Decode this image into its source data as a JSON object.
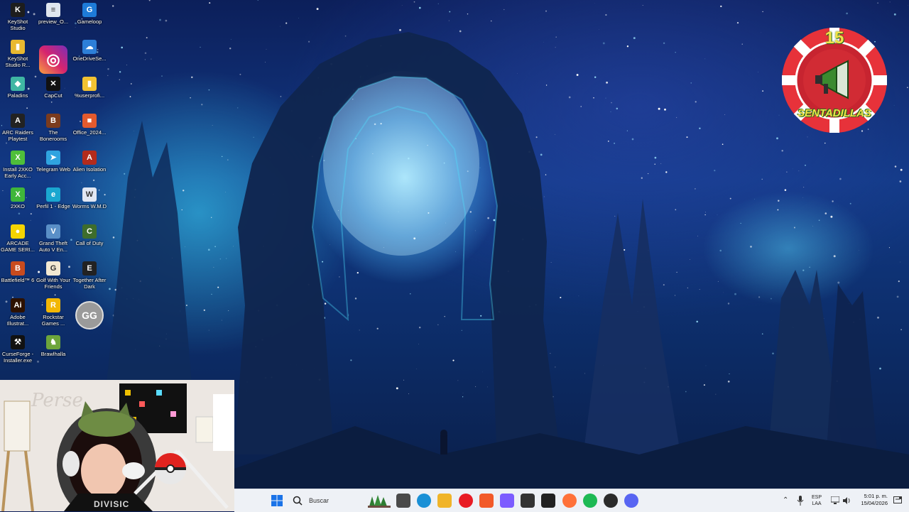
{
  "desktop": {
    "icons": [
      {
        "label": "KeyShot Studio",
        "glyph": "K",
        "color": "#1d1d1d",
        "icon": "keyshot-icon"
      },
      {
        "label": "preview_O...",
        "glyph": "≡",
        "color": "#dfe6ef",
        "icon": "document-icon"
      },
      {
        "label": "Gameloop",
        "glyph": "G",
        "color": "#1e7bd8",
        "icon": "gameloop-icon"
      },
      {
        "label": "KeyShot Studio R...",
        "glyph": "▮",
        "color": "#e9b930",
        "icon": "folder-icon"
      },
      {
        "label": "",
        "glyph": "◎",
        "color": "#c1355b",
        "icon": "instagram-icon"
      },
      {
        "label": "OneDriveSe...",
        "glyph": "☁",
        "color": "#2d7fd8",
        "icon": "onedrive-icon"
      },
      {
        "label": "Paladins",
        "glyph": "◆",
        "color": "#3fb6a3",
        "icon": "paladins-icon"
      },
      {
        "label": "CapCut",
        "glyph": "✕",
        "color": "#111111",
        "icon": "capcut-icon"
      },
      {
        "label": "%userprofi...",
        "glyph": "▮",
        "color": "#f1c232",
        "icon": "folder-icon"
      },
      {
        "label": "ARC Raiders Playtest",
        "glyph": "A",
        "color": "#222222",
        "icon": "arc-raiders-icon"
      },
      {
        "label": "The Bonerooms",
        "glyph": "B",
        "color": "#7b3b1e",
        "icon": "bonerooms-icon"
      },
      {
        "label": "Office_2024...",
        "glyph": "■",
        "color": "#e35a2e",
        "icon": "office-icon"
      },
      {
        "label": "Install 2XKO Early Acc...",
        "glyph": "X",
        "color": "#4fbf3a",
        "icon": "2xko-installer-icon"
      },
      {
        "label": "Telegram Web",
        "glyph": "➤",
        "color": "#2fa3e0",
        "icon": "telegram-icon"
      },
      {
        "label": "Alien Isolation",
        "glyph": "A",
        "color": "#b32b1c",
        "icon": "alien-isolation-icon"
      },
      {
        "label": "2XKO",
        "glyph": "X",
        "color": "#3fb63a",
        "icon": "2xko-icon"
      },
      {
        "label": "Perfil 1 - Edge",
        "glyph": "e",
        "color": "#1aa7d0",
        "icon": "edge-icon"
      },
      {
        "label": "Worms W.M.D",
        "glyph": "W",
        "color": "#e1e7f3",
        "icon": "worms-icon"
      },
      {
        "label": "ARCADE GAME SERI...",
        "glyph": "●",
        "color": "#f5d400",
        "icon": "pacman-icon"
      },
      {
        "label": "Grand Theft Auto V En...",
        "glyph": "V",
        "color": "#5a8fc7",
        "icon": "gta-icon"
      },
      {
        "label": "Call of Duty",
        "glyph": "C",
        "color": "#3e6d2c",
        "icon": "call-of-duty-icon"
      },
      {
        "label": "Battlefield™ 6",
        "glyph": "B",
        "color": "#c84b1e",
        "icon": "battlefield-icon"
      },
      {
        "label": "Golf With Your Friends",
        "glyph": "G",
        "color": "#f2e8d2",
        "icon": "golf-icon"
      },
      {
        "label": "Together After Dark",
        "glyph": "E",
        "color": "#222222",
        "icon": "epic-games-icon"
      },
      {
        "label": "Adobe Illustrat...",
        "glyph": "Ai",
        "color": "#2d1100",
        "icon": "illustrator-icon"
      },
      {
        "label": "Rockstar Games ...",
        "glyph": "R",
        "color": "#f2b705",
        "icon": "rockstar-icon"
      },
      {
        "label": "",
        "glyph": "GG",
        "color": "#9a9a9a",
        "icon": "gg-icon"
      },
      {
        "label": "CurseForge - Installer.exe",
        "glyph": "⚒",
        "color": "#111111",
        "icon": "curseforge-icon"
      },
      {
        "label": "Brawlhalla",
        "glyph": "♞",
        "color": "#6da53b",
        "icon": "brawlhalla-icon"
      }
    ]
  },
  "badge": {
    "number": "15",
    "text": "SENTADILLAS"
  },
  "webcam": {
    "wall_text": "Perse",
    "shirt_text": "DIVISIC"
  },
  "taskbar": {
    "search_placeholder": "Buscar",
    "apps": [
      {
        "name": "task-view",
        "color": "#4a4a4a"
      },
      {
        "name": "edge",
        "color": "#1a90d6"
      },
      {
        "name": "file-explorer",
        "color": "#f0b429"
      },
      {
        "name": "opera",
        "color": "#e81b24"
      },
      {
        "name": "brave",
        "color": "#f25a29"
      },
      {
        "name": "copilot",
        "color": "#7c5cff"
      },
      {
        "name": "unity",
        "color": "#333333"
      },
      {
        "name": "epic-games",
        "color": "#222222"
      },
      {
        "name": "firefox",
        "color": "#ff7139"
      },
      {
        "name": "spotify",
        "color": "#1db954"
      },
      {
        "name": "davinci",
        "color": "#2b2b2b"
      },
      {
        "name": "discord",
        "color": "#5865f2"
      }
    ],
    "lang_top": "ESP",
    "lang_bottom": "LAA",
    "time": "5:01 p. m.",
    "date": "15/04/2026"
  }
}
